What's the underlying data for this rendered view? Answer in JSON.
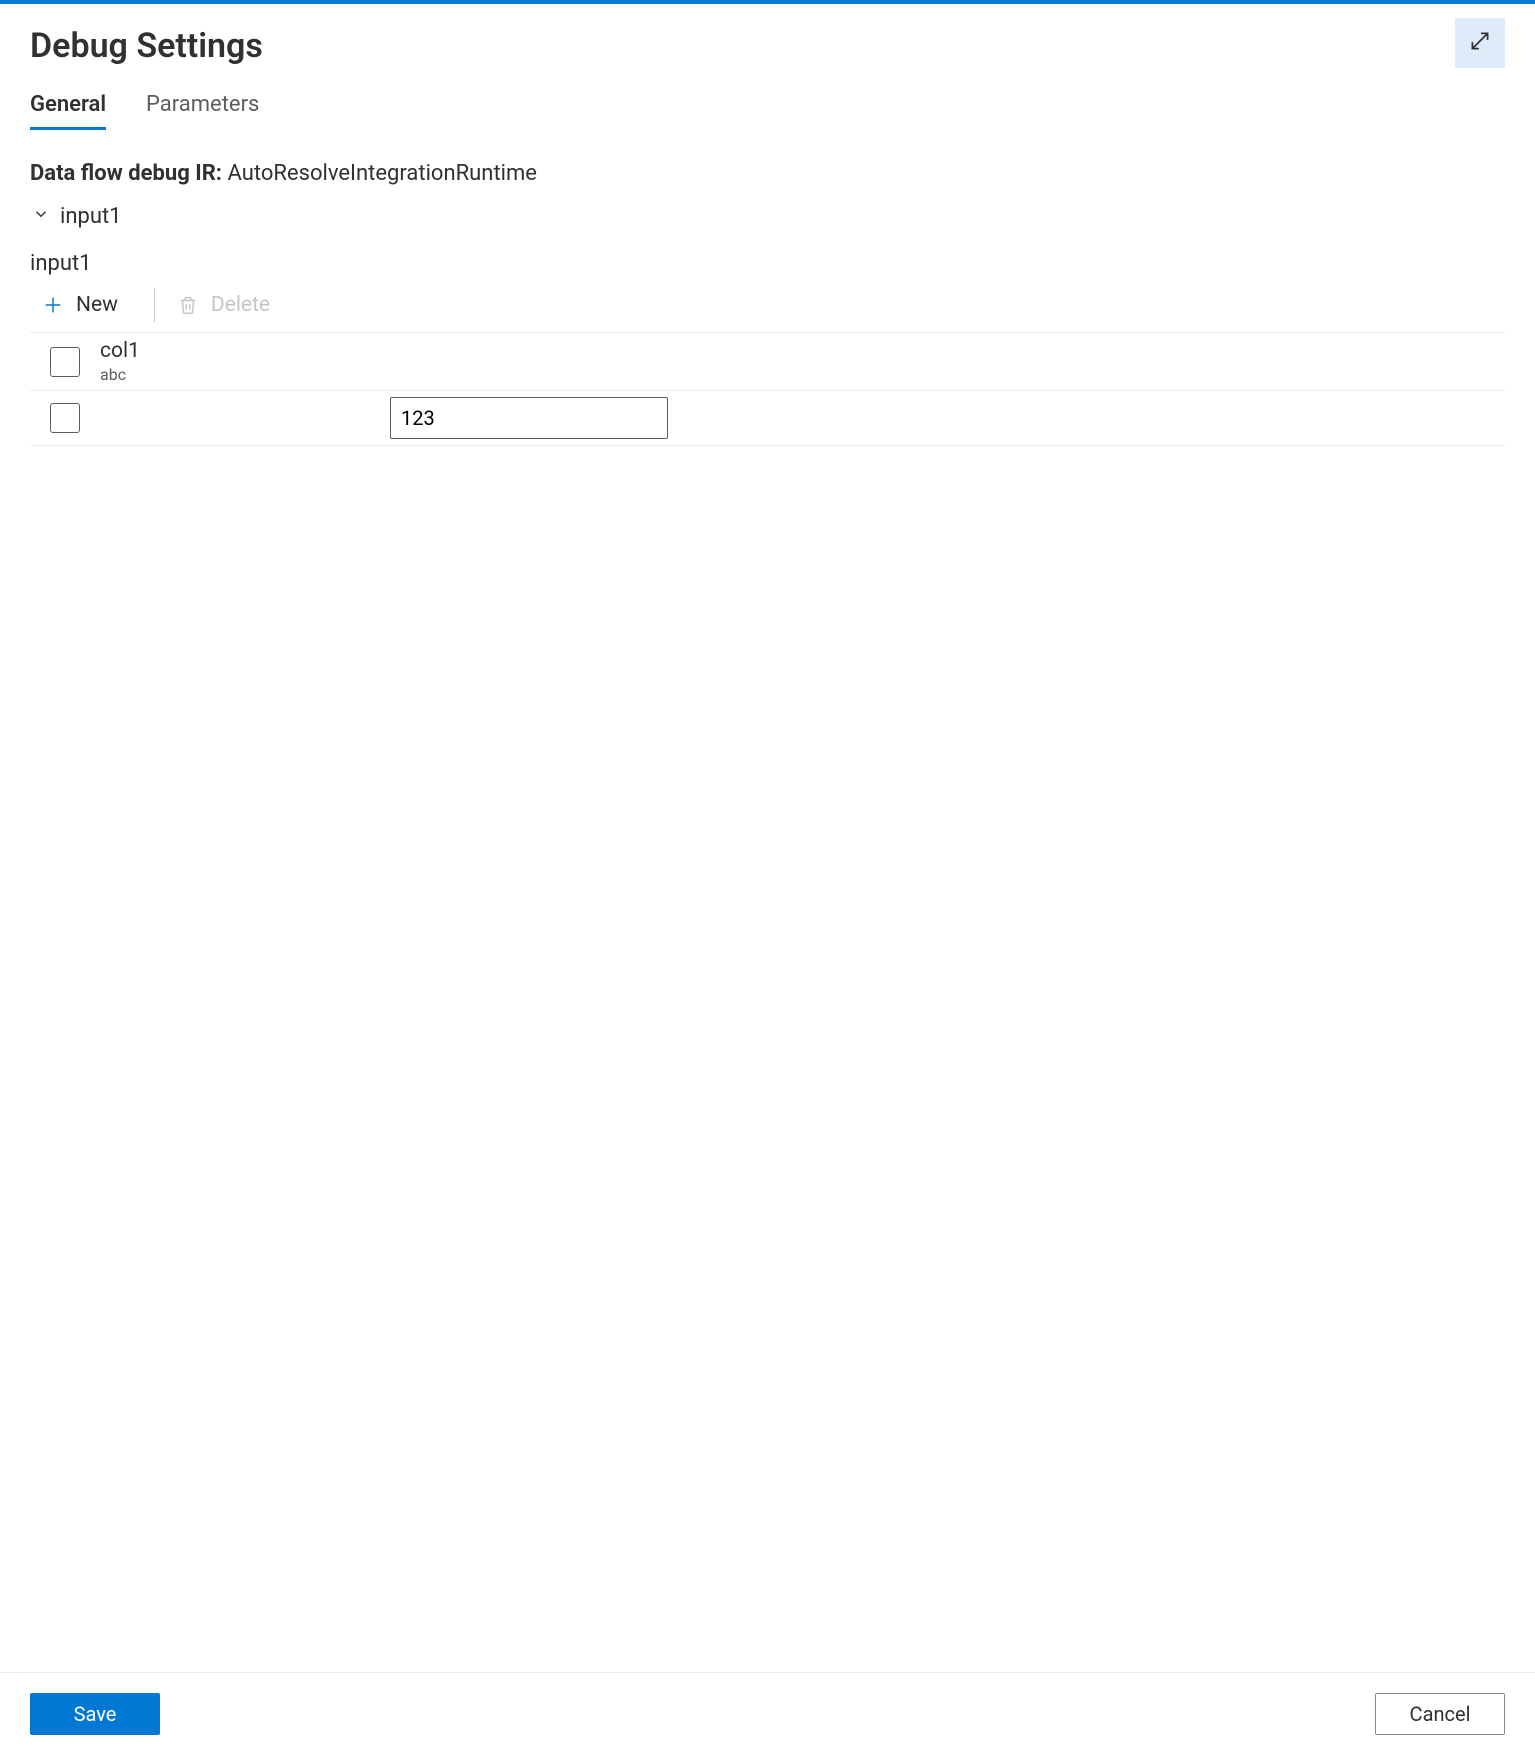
{
  "header": {
    "title": "Debug Settings"
  },
  "tabs": {
    "general": "General",
    "parameters": "Parameters"
  },
  "ir": {
    "label": "Data flow debug IR:",
    "value": "AutoResolveIntegrationRuntime"
  },
  "group": {
    "name": "input1",
    "heading": "input1"
  },
  "toolbar": {
    "new": "New",
    "delete": "Delete"
  },
  "table": {
    "column": {
      "name": "col1",
      "type": "abc"
    },
    "row1": {
      "value": "123"
    }
  },
  "footer": {
    "save": "Save",
    "cancel": "Cancel"
  }
}
